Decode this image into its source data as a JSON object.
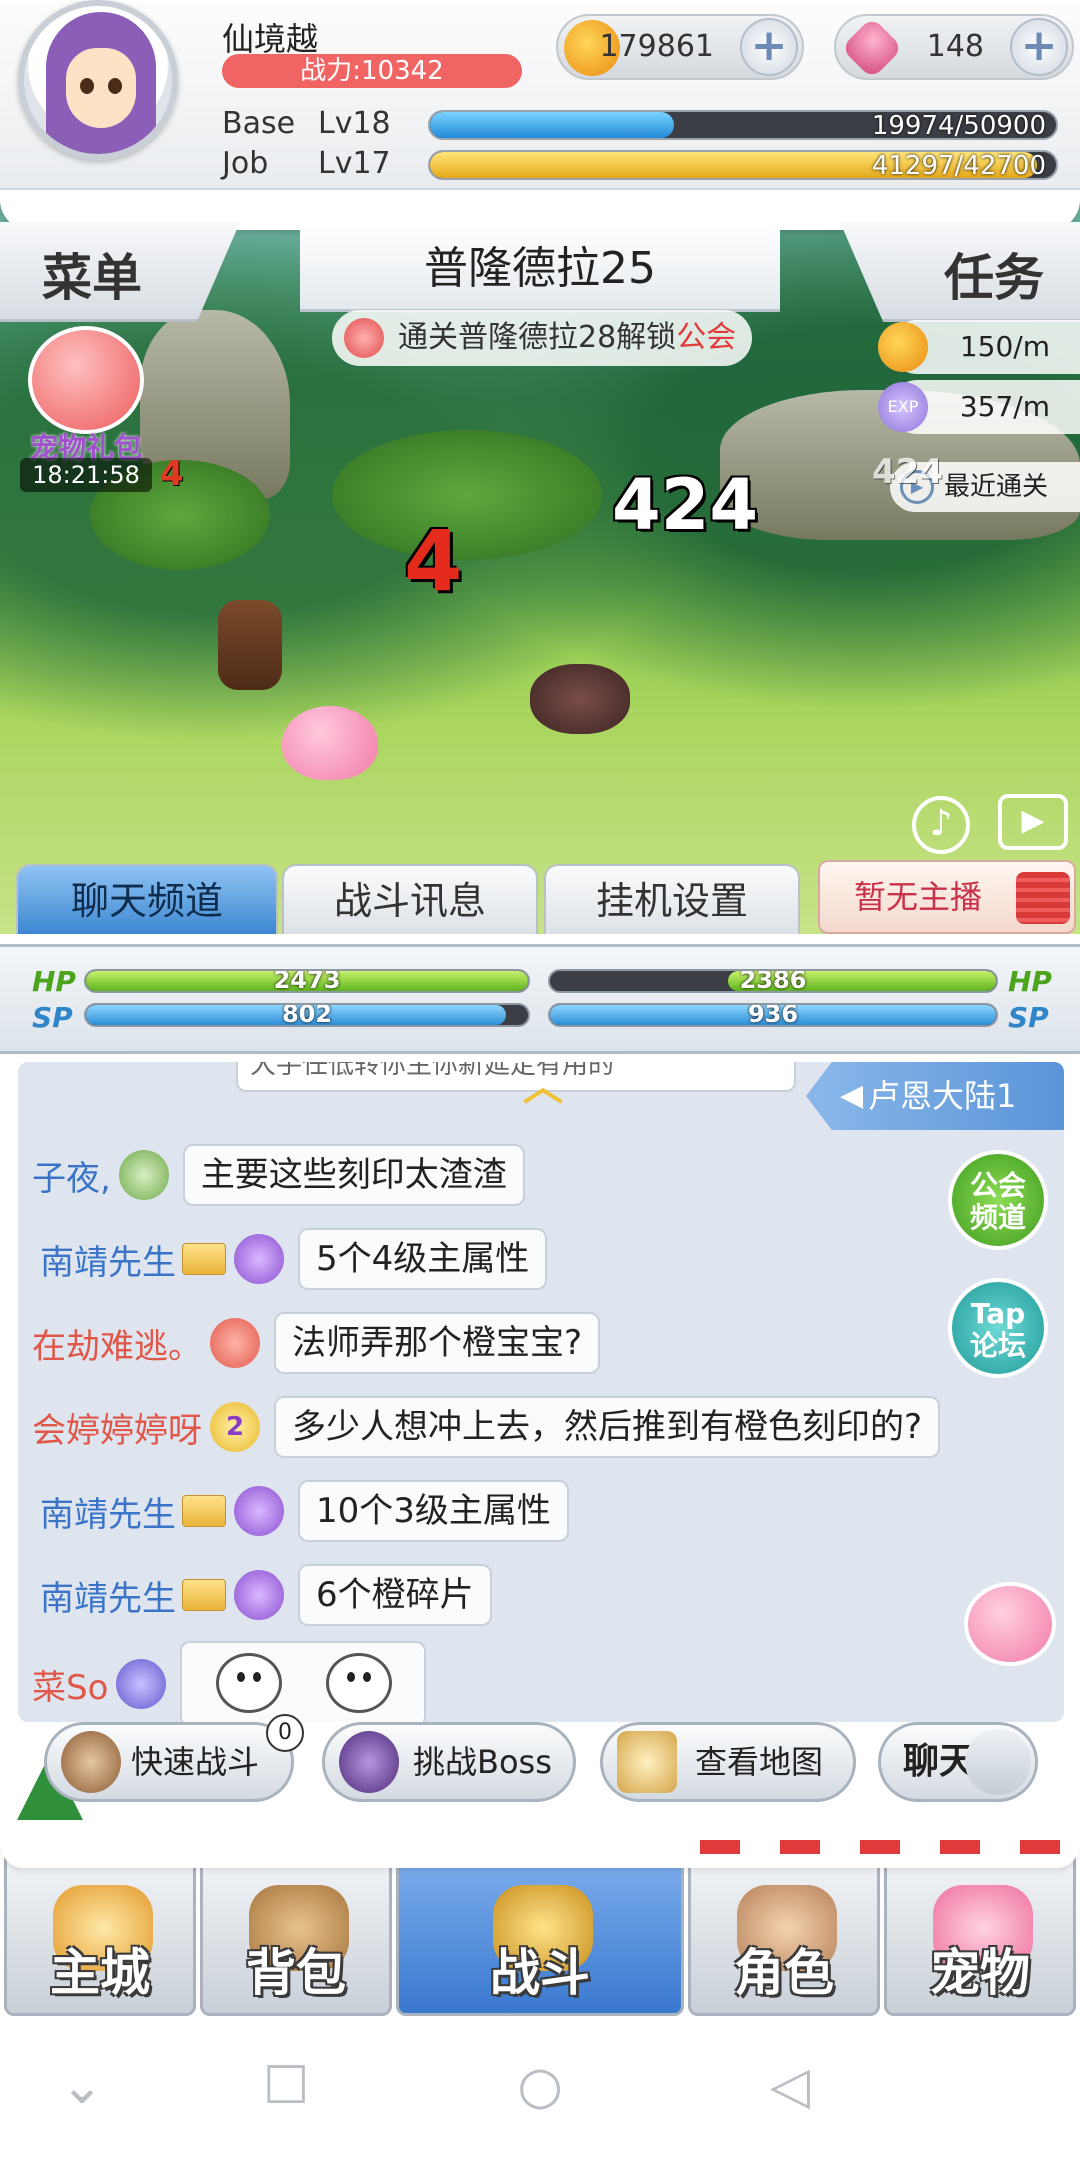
{
  "header": {
    "player_name": "仙境越",
    "power": "战力:10342",
    "gold": "179861",
    "gems": "148",
    "base_label": "Base",
    "base_level": "Lv18",
    "base_exp": "19974/50900",
    "base_exp_fraction": 0.39,
    "job_label": "Job",
    "job_level": "Lv17",
    "job_exp": "41297/42700",
    "job_exp_fraction": 0.97
  },
  "scene": {
    "menu_label": "菜单",
    "quest_label": "任务",
    "map_name": "普隆德拉25",
    "unlock_text": "通关普隆德拉28解锁",
    "unlock_feature": "公会",
    "pet_gift_label": "宠物礼包",
    "pet_gift_timer": "18:21:58",
    "gold_rate": "150/m",
    "exp_rate": "357/m",
    "exp_icon_text": "EXP",
    "last_clear": "最近通关",
    "damage_numbers": [
      "4",
      "424",
      "4",
      "424"
    ]
  },
  "tabs": {
    "chat": "聊天频道",
    "battle": "战斗讯息",
    "idle": "挂机设置",
    "broadcast": "暂无主播"
  },
  "stats": {
    "hp_label": "HP",
    "sp_label": "SP",
    "player_hp": "2473",
    "player_sp": "802",
    "enemy_hp": "2386",
    "enemy_sp": "936",
    "player_hp_fraction": 1.0,
    "player_sp_fraction": 0.95,
    "enemy_hp_fraction": 0.6,
    "enemy_sp_fraction": 1.0
  },
  "chat": {
    "region": "卢恩大陆1",
    "cut_text": "大手任低转你主你新延定有用的",
    "guild_channel": "公会\n频道",
    "tap_forum": "Tap\n论坛",
    "messages": [
      {
        "name": "子夜,",
        "text": "主要这些刻印太渣渣"
      },
      {
        "name": "南靖先生",
        "text": "5个4级主属性"
      },
      {
        "name": "在劫难逃。",
        "text": "法师弄那个橙宝宝?"
      },
      {
        "name": "会婷婷婷呀",
        "badge": "2",
        "text": "多少人想冲上去，然后推到有橙色刻印的?"
      },
      {
        "name": "南靖先生",
        "text": "10个3级主属性"
      },
      {
        "name": "南靖先生",
        "text": "6个橙碎片"
      },
      {
        "name": "菜So"
      }
    ]
  },
  "actions": {
    "quick_battle": "快速战斗",
    "quick_battle_count": "0",
    "boss": "挑战Boss",
    "map": "查看地图",
    "chat": "聊天"
  },
  "nav": {
    "city": "主城",
    "bag": "背包",
    "battle": "战斗",
    "character": "角色",
    "pet": "宠物"
  },
  "system_nav": {
    "hide": "⌄",
    "recent": "☐",
    "home": "○",
    "back": "◁"
  }
}
